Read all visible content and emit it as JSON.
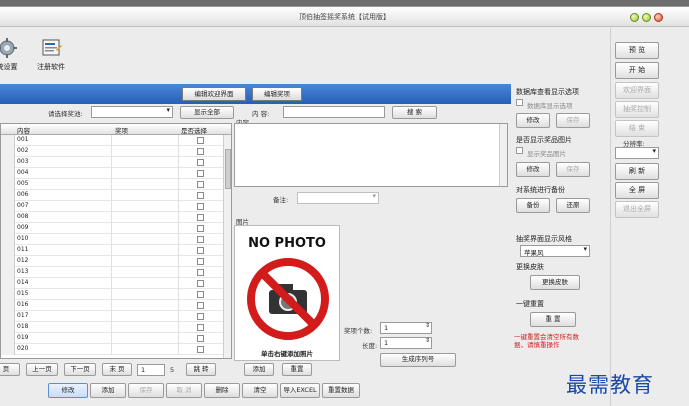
{
  "window": {
    "title": "顶伯抽签摇奖系统【试用版】"
  },
  "toolbar": {
    "items": [
      {
        "label": "统设置",
        "icon": "gear-icon"
      },
      {
        "label": "注册软件",
        "icon": "register-icon"
      }
    ]
  },
  "bluebar": {
    "btn1": "编辑欢迎界面",
    "btn2": "编辑奖项"
  },
  "search": {
    "select_label": "请选择奖池:",
    "select_value": "",
    "show_all": "显示全部",
    "content_label": "内 容:",
    "content_value": "",
    "search_btn": "搜 索"
  },
  "table": {
    "headers": [
      "内容",
      "奖项",
      "是否选择"
    ],
    "rows": [
      "001",
      "002",
      "003",
      "004",
      "005",
      "006",
      "007",
      "008",
      "009",
      "010",
      "011",
      "012",
      "013",
      "014",
      "015",
      "016",
      "017",
      "018",
      "019",
      "020"
    ]
  },
  "content_panel": {
    "content_label": "内容",
    "note_label": "备注:",
    "pic_label": "图片",
    "no_photo": "NO PHOTO",
    "pic_hint": "单击右键添加照片"
  },
  "prize_settings": {
    "count_label": "奖项个数:",
    "count_value": "1",
    "length_label": "长度:",
    "length_value": "1",
    "generate_btn": "生成序列号"
  },
  "pager": {
    "prev": "上一页",
    "next": "下一页",
    "last": "末 页",
    "page_value": "1",
    "total": "5",
    "jump": "跳 转",
    "first_tail": "页"
  },
  "pic_buttons": {
    "add": "添加",
    "reset": "重置"
  },
  "bottombar": {
    "buttons": [
      "修改",
      "添加",
      "保存",
      "取 消",
      "删除",
      "清空",
      "导入EXCEL",
      "重置数据"
    ]
  },
  "right_panel": {
    "sec1_title": "数据库查看显示选项",
    "sec1_checkbox": "数据库显示选项",
    "sec1_modify": "修改",
    "sec1_save": "保存",
    "sec2_title": "是否显示奖品图片",
    "sec2_checkbox": "显示奖品图片",
    "sec2_modify": "修改",
    "sec2_save": "保存",
    "sec3_title": "对系统进行备份",
    "sec3_backup": "备份",
    "sec3_restore": "还原",
    "sec4_title": "抽奖界面显示风格",
    "sec4_value": "苹果风",
    "sec5_title": "更换皮肤",
    "sec5_btn": "更换皮肤",
    "sec6_title": "一键重置",
    "sec6_btn": "重 置",
    "sec6_warn": "一键重置会清空所有数据，请慎重操作"
  },
  "side_panel": {
    "preview": "预 览",
    "start": "开 始",
    "welcome": "欢迎界面",
    "lottery": "抽奖控制",
    "end": "结 束",
    "resolution_label": "分辨率:",
    "resolution_value": "",
    "refresh": "刷 新",
    "fullscreen": "全 屏",
    "exit_fullscreen": "退出全屏"
  },
  "watermark": "最需教育",
  "colors": {
    "accent": "#2b66bd",
    "warn": "#d42020",
    "watermark": "#1a4aa8"
  }
}
